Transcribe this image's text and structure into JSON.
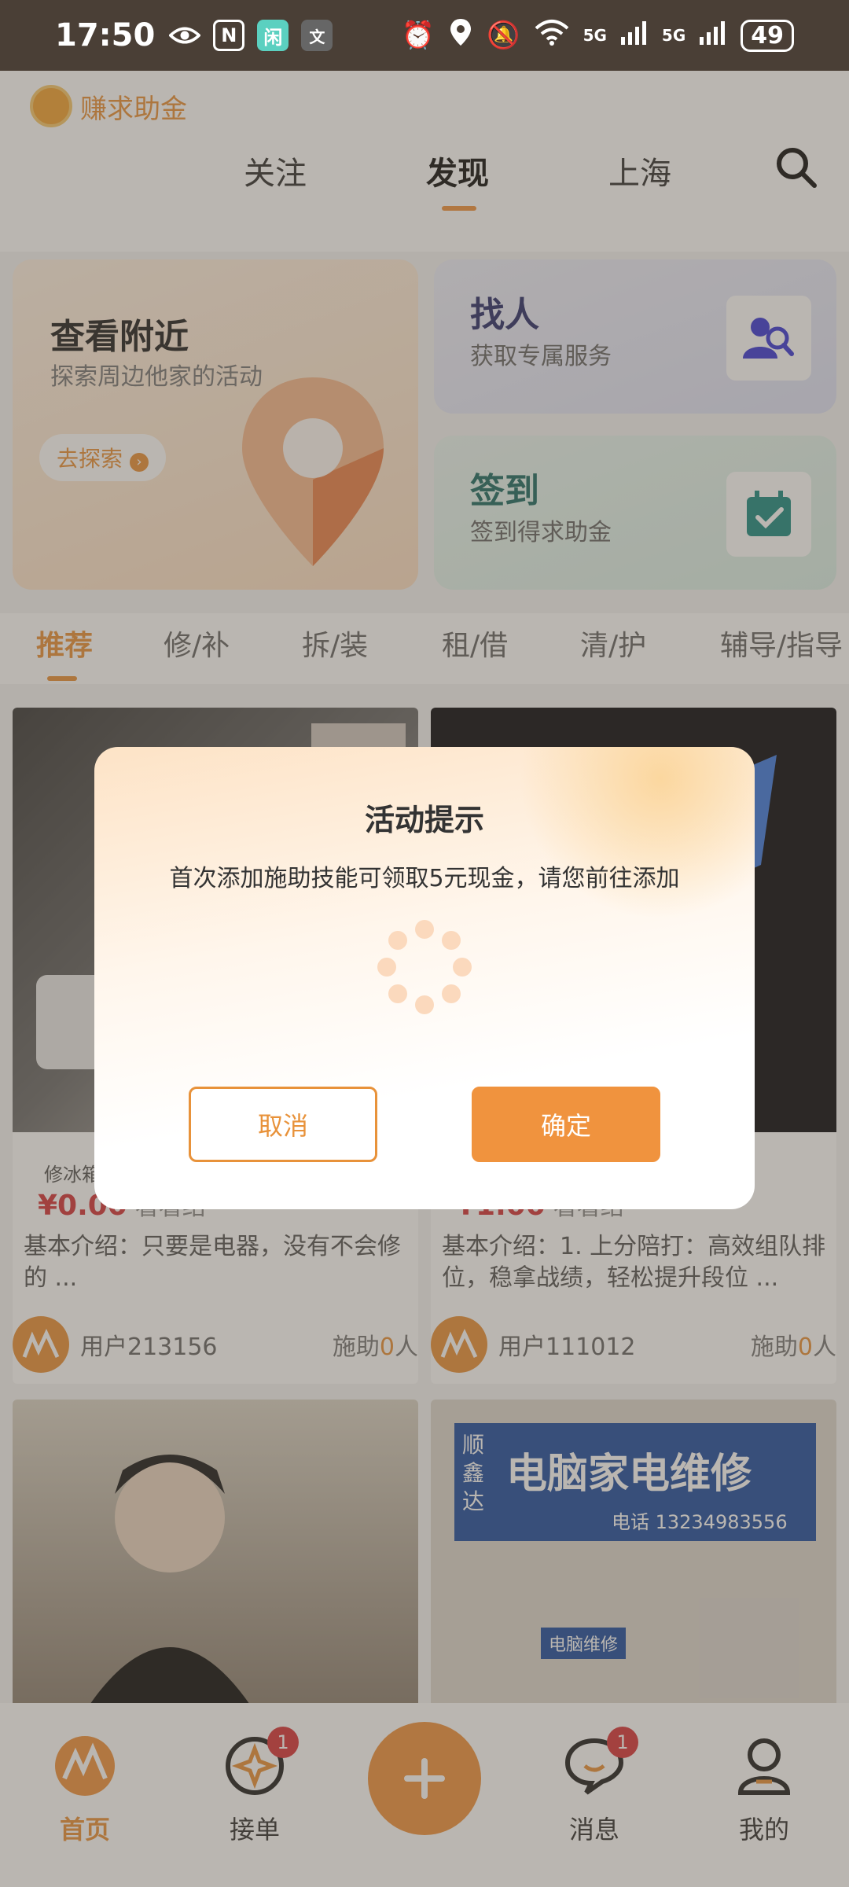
{
  "status_bar": {
    "time": "17:50",
    "battery": "49",
    "network_labels": [
      "5G",
      "5G"
    ]
  },
  "top_nav": {
    "logo_text": "赚求助金",
    "tabs": [
      "关注",
      "发现",
      "上海"
    ],
    "active_tab": "发现"
  },
  "banners": {
    "nearby": {
      "title": "查看附近",
      "subtitle": "探索周边他家的活动",
      "button": "去探索"
    },
    "find_people": {
      "title": "找人",
      "subtitle": "获取专属服务"
    },
    "sign_in": {
      "title": "签到",
      "subtitle": "签到得求助金"
    }
  },
  "categories": [
    "推荐",
    "修/补",
    "拆/装",
    "租/借",
    "清/护",
    "辅导/指导"
  ],
  "active_category": "推荐",
  "items": [
    {
      "tag": "修冰箱",
      "price": "¥0.00",
      "peek": "看看结",
      "desc": "基本介绍：只要是电器，没有不会修的 ...",
      "user": "用户213156",
      "helpers_label": "施助",
      "helpers_count": "0",
      "helpers_unit": "人"
    },
    {
      "tag": "",
      "price": "¥1.00",
      "peek": "看看结",
      "desc": "基本介绍：1. 上分陪打：高效组队排位，稳拿战绩，轻松提升段位 ...",
      "user": "用户111012",
      "helpers_label": "施助",
      "helpers_count": "0",
      "helpers_unit": "人"
    },
    {
      "sign_text": ""
    },
    {
      "sign_line1": "顺鑫达",
      "sign_line2": "电脑家电维修",
      "sign_phone": "电话 13234983556",
      "shop_sign": "电脑维修"
    }
  ],
  "bottom_nav": {
    "home": "首页",
    "orders": "接单",
    "orders_badge": "1",
    "messages": "消息",
    "messages_badge": "1",
    "mine": "我的"
  },
  "modal": {
    "title": "活动提示",
    "message": "首次添加施助技能可领取5元现金，请您前往添加",
    "cancel": "取消",
    "confirm": "确定"
  },
  "colors": {
    "accent": "#f0933e",
    "price_red": "#d4363b",
    "status_bar": "#4a3f36"
  }
}
